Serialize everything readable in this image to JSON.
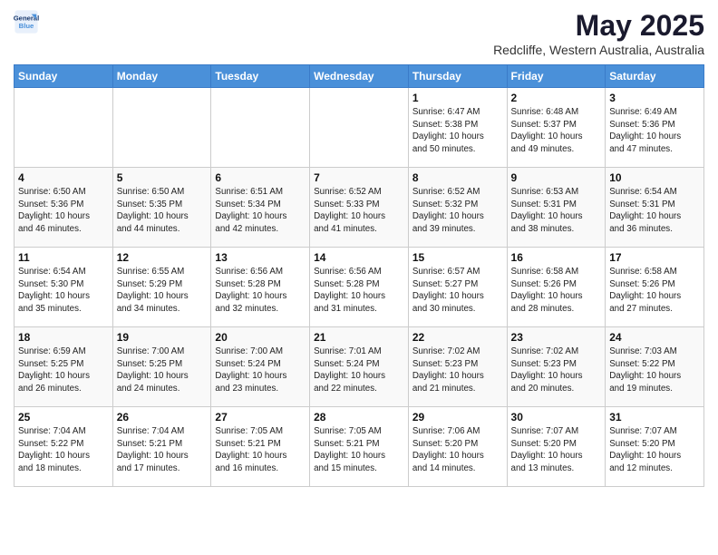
{
  "header": {
    "logo_line1": "General",
    "logo_line2": "Blue",
    "month": "May 2025",
    "location": "Redcliffe, Western Australia, Australia"
  },
  "weekdays": [
    "Sunday",
    "Monday",
    "Tuesday",
    "Wednesday",
    "Thursday",
    "Friday",
    "Saturday"
  ],
  "weeks": [
    [
      {
        "day": "",
        "info": ""
      },
      {
        "day": "",
        "info": ""
      },
      {
        "day": "",
        "info": ""
      },
      {
        "day": "",
        "info": ""
      },
      {
        "day": "1",
        "info": "Sunrise: 6:47 AM\nSunset: 5:38 PM\nDaylight: 10 hours\nand 50 minutes."
      },
      {
        "day": "2",
        "info": "Sunrise: 6:48 AM\nSunset: 5:37 PM\nDaylight: 10 hours\nand 49 minutes."
      },
      {
        "day": "3",
        "info": "Sunrise: 6:49 AM\nSunset: 5:36 PM\nDaylight: 10 hours\nand 47 minutes."
      }
    ],
    [
      {
        "day": "4",
        "info": "Sunrise: 6:50 AM\nSunset: 5:36 PM\nDaylight: 10 hours\nand 46 minutes."
      },
      {
        "day": "5",
        "info": "Sunrise: 6:50 AM\nSunset: 5:35 PM\nDaylight: 10 hours\nand 44 minutes."
      },
      {
        "day": "6",
        "info": "Sunrise: 6:51 AM\nSunset: 5:34 PM\nDaylight: 10 hours\nand 42 minutes."
      },
      {
        "day": "7",
        "info": "Sunrise: 6:52 AM\nSunset: 5:33 PM\nDaylight: 10 hours\nand 41 minutes."
      },
      {
        "day": "8",
        "info": "Sunrise: 6:52 AM\nSunset: 5:32 PM\nDaylight: 10 hours\nand 39 minutes."
      },
      {
        "day": "9",
        "info": "Sunrise: 6:53 AM\nSunset: 5:31 PM\nDaylight: 10 hours\nand 38 minutes."
      },
      {
        "day": "10",
        "info": "Sunrise: 6:54 AM\nSunset: 5:31 PM\nDaylight: 10 hours\nand 36 minutes."
      }
    ],
    [
      {
        "day": "11",
        "info": "Sunrise: 6:54 AM\nSunset: 5:30 PM\nDaylight: 10 hours\nand 35 minutes."
      },
      {
        "day": "12",
        "info": "Sunrise: 6:55 AM\nSunset: 5:29 PM\nDaylight: 10 hours\nand 34 minutes."
      },
      {
        "day": "13",
        "info": "Sunrise: 6:56 AM\nSunset: 5:28 PM\nDaylight: 10 hours\nand 32 minutes."
      },
      {
        "day": "14",
        "info": "Sunrise: 6:56 AM\nSunset: 5:28 PM\nDaylight: 10 hours\nand 31 minutes."
      },
      {
        "day": "15",
        "info": "Sunrise: 6:57 AM\nSunset: 5:27 PM\nDaylight: 10 hours\nand 30 minutes."
      },
      {
        "day": "16",
        "info": "Sunrise: 6:58 AM\nSunset: 5:26 PM\nDaylight: 10 hours\nand 28 minutes."
      },
      {
        "day": "17",
        "info": "Sunrise: 6:58 AM\nSunset: 5:26 PM\nDaylight: 10 hours\nand 27 minutes."
      }
    ],
    [
      {
        "day": "18",
        "info": "Sunrise: 6:59 AM\nSunset: 5:25 PM\nDaylight: 10 hours\nand 26 minutes."
      },
      {
        "day": "19",
        "info": "Sunrise: 7:00 AM\nSunset: 5:25 PM\nDaylight: 10 hours\nand 24 minutes."
      },
      {
        "day": "20",
        "info": "Sunrise: 7:00 AM\nSunset: 5:24 PM\nDaylight: 10 hours\nand 23 minutes."
      },
      {
        "day": "21",
        "info": "Sunrise: 7:01 AM\nSunset: 5:24 PM\nDaylight: 10 hours\nand 22 minutes."
      },
      {
        "day": "22",
        "info": "Sunrise: 7:02 AM\nSunset: 5:23 PM\nDaylight: 10 hours\nand 21 minutes."
      },
      {
        "day": "23",
        "info": "Sunrise: 7:02 AM\nSunset: 5:23 PM\nDaylight: 10 hours\nand 20 minutes."
      },
      {
        "day": "24",
        "info": "Sunrise: 7:03 AM\nSunset: 5:22 PM\nDaylight: 10 hours\nand 19 minutes."
      }
    ],
    [
      {
        "day": "25",
        "info": "Sunrise: 7:04 AM\nSunset: 5:22 PM\nDaylight: 10 hours\nand 18 minutes."
      },
      {
        "day": "26",
        "info": "Sunrise: 7:04 AM\nSunset: 5:21 PM\nDaylight: 10 hours\nand 17 minutes."
      },
      {
        "day": "27",
        "info": "Sunrise: 7:05 AM\nSunset: 5:21 PM\nDaylight: 10 hours\nand 16 minutes."
      },
      {
        "day": "28",
        "info": "Sunrise: 7:05 AM\nSunset: 5:21 PM\nDaylight: 10 hours\nand 15 minutes."
      },
      {
        "day": "29",
        "info": "Sunrise: 7:06 AM\nSunset: 5:20 PM\nDaylight: 10 hours\nand 14 minutes."
      },
      {
        "day": "30",
        "info": "Sunrise: 7:07 AM\nSunset: 5:20 PM\nDaylight: 10 hours\nand 13 minutes."
      },
      {
        "day": "31",
        "info": "Sunrise: 7:07 AM\nSunset: 5:20 PM\nDaylight: 10 hours\nand 12 minutes."
      }
    ]
  ]
}
